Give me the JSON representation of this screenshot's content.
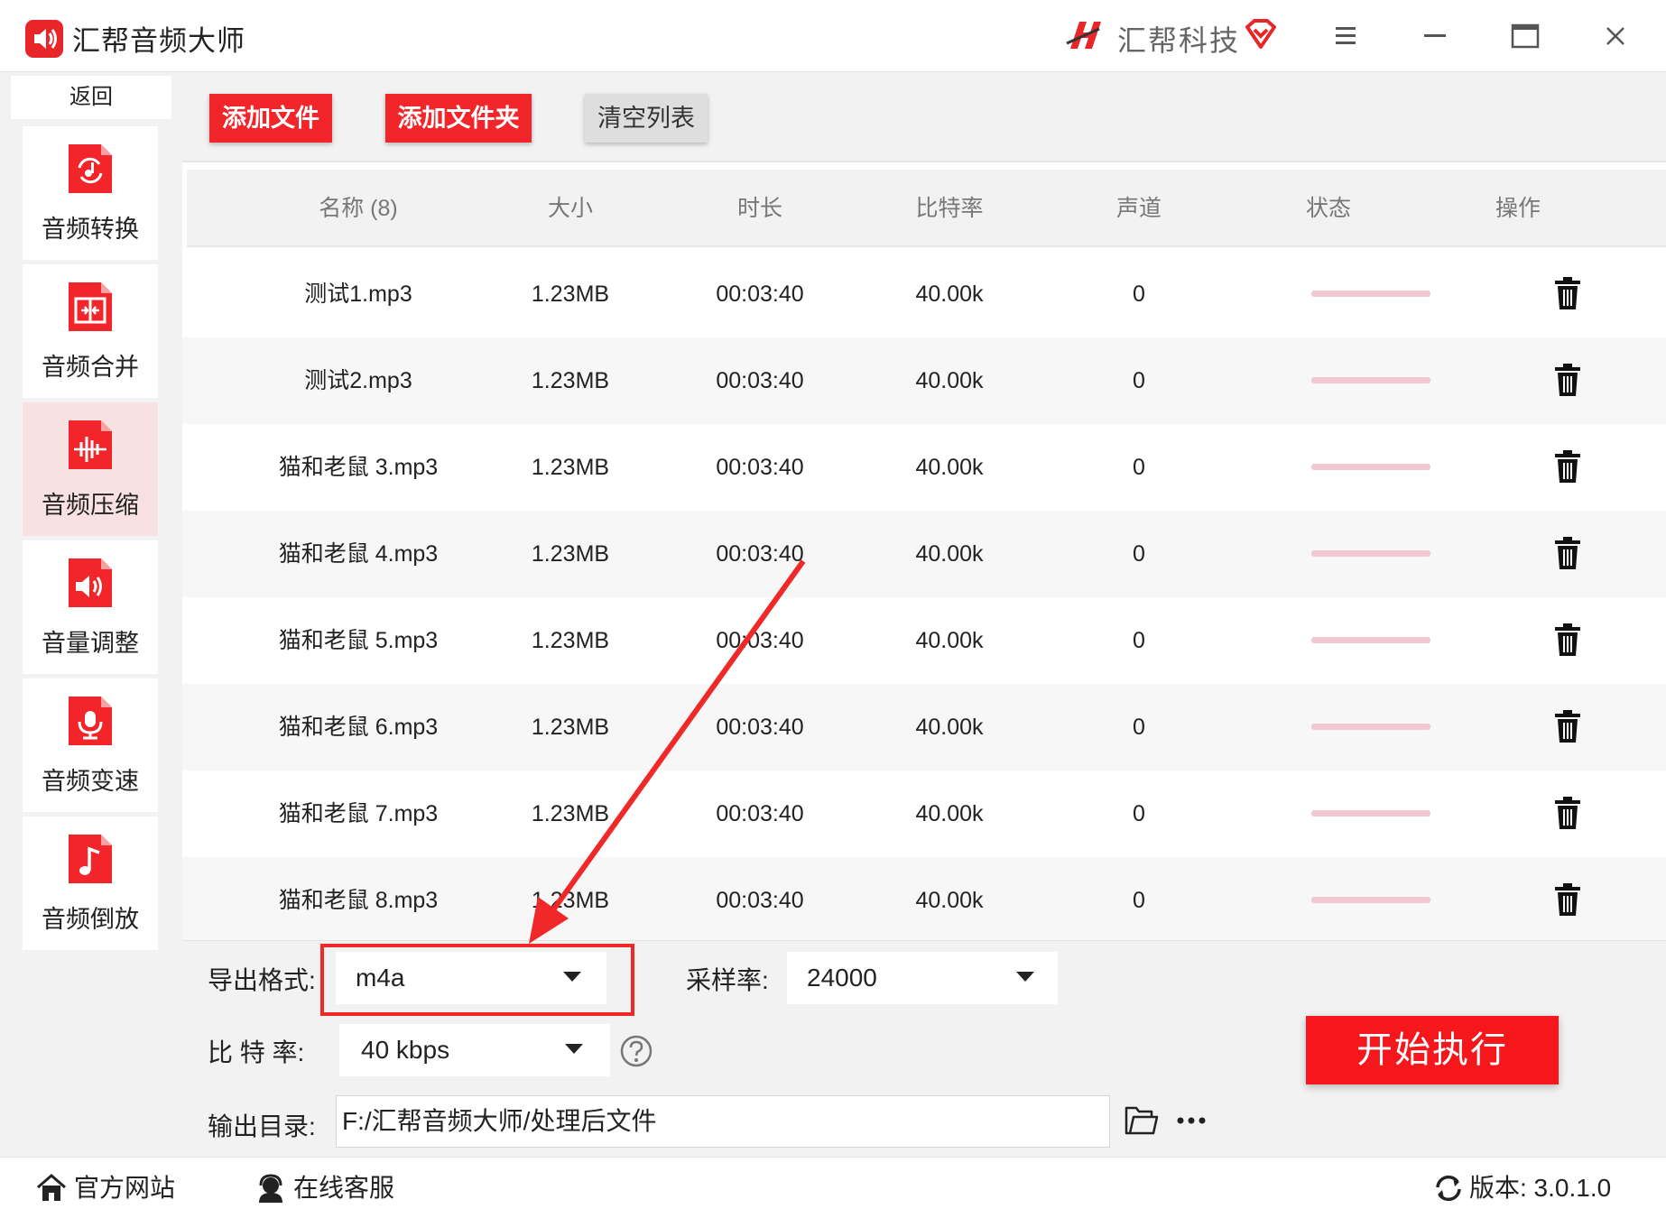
{
  "app": {
    "title": "汇帮音频大师",
    "brand": "汇帮科技"
  },
  "sidebar": {
    "back_label": "返回",
    "items": [
      {
        "label": "音频转换",
        "icon": "audio-convert-icon"
      },
      {
        "label": "音频合并",
        "icon": "audio-merge-icon"
      },
      {
        "label": "音频压缩",
        "icon": "audio-compress-icon",
        "active": true
      },
      {
        "label": "音量调整",
        "icon": "volume-adjust-icon"
      },
      {
        "label": "音频变速",
        "icon": "audio-speed-icon"
      },
      {
        "label": "音频倒放",
        "icon": "audio-reverse-icon"
      }
    ]
  },
  "toolbar": {
    "add_file": "添加文件",
    "add_folder": "添加文件夹",
    "clear_list": "清空列表"
  },
  "table": {
    "headers": [
      "名称 (8)",
      "大小",
      "时长",
      "比特率",
      "声道",
      "状态",
      "操作"
    ],
    "rows": [
      {
        "name": "测试1.mp3",
        "size": "1.23MB",
        "duration": "00:03:40",
        "bitrate": "40.00k",
        "channels": "0"
      },
      {
        "name": "测试2.mp3",
        "size": "1.23MB",
        "duration": "00:03:40",
        "bitrate": "40.00k",
        "channels": "0"
      },
      {
        "name": "猫和老鼠 3.mp3",
        "size": "1.23MB",
        "duration": "00:03:40",
        "bitrate": "40.00k",
        "channels": "0"
      },
      {
        "name": "猫和老鼠 4.mp3",
        "size": "1.23MB",
        "duration": "00:03:40",
        "bitrate": "40.00k",
        "channels": "0"
      },
      {
        "name": "猫和老鼠 5.mp3",
        "size": "1.23MB",
        "duration": "00:03:40",
        "bitrate": "40.00k",
        "channels": "0"
      },
      {
        "name": "猫和老鼠 6.mp3",
        "size": "1.23MB",
        "duration": "00:03:40",
        "bitrate": "40.00k",
        "channels": "0"
      },
      {
        "name": "猫和老鼠 7.mp3",
        "size": "1.23MB",
        "duration": "00:03:40",
        "bitrate": "40.00k",
        "channels": "0"
      },
      {
        "name": "猫和老鼠 8.mp3",
        "size": "1.23MB",
        "duration": "00:03:40",
        "bitrate": "40.00k",
        "channels": "0"
      }
    ]
  },
  "settings": {
    "format_label": "导出格式:",
    "format_value": "m4a",
    "samplerate_label": "采样率:",
    "samplerate_value": "24000",
    "bitrate_label": "比 特 率:",
    "bitrate_value": "40 kbps",
    "output_label": "输出目录:",
    "output_path": "F:/汇帮音频大师/处理后文件",
    "start_label": "开始执行"
  },
  "footer": {
    "website": "官方网站",
    "support": "在线客服",
    "version": "版本:  3.0.1.0"
  },
  "colors": {
    "accent_red": "#f2262a",
    "status_pink": "#f1c7d1",
    "active_nav": "#f8e1e2"
  }
}
